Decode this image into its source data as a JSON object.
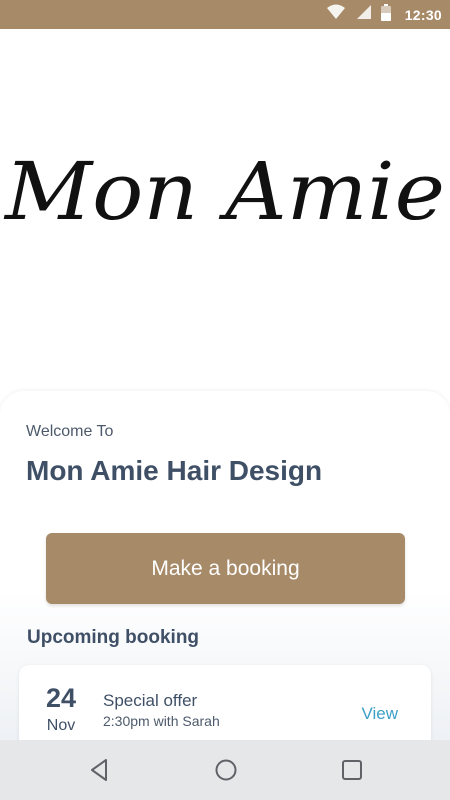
{
  "status_bar": {
    "time": "12:30",
    "icons": [
      "wifi-icon",
      "signal-icon",
      "battery-icon"
    ],
    "color": "#a78b69"
  },
  "logo": {
    "text": "Mon Amie"
  },
  "welcome": {
    "greeting": "Welcome To",
    "salon_name": "Mon Amie Hair Design"
  },
  "booking_button": {
    "label": "Make a booking",
    "color": "#a78b69"
  },
  "upcoming": {
    "title": "Upcoming booking",
    "item": {
      "day": "24",
      "month": "Nov",
      "title": "Special offer",
      "details": "2:30pm with Sarah",
      "action": "View"
    }
  },
  "nav_bar": {
    "buttons": [
      "back-icon",
      "home-icon",
      "recents-icon"
    ]
  },
  "colors": {
    "heading": "#3f5066",
    "link": "#3b9fc6",
    "accent": "#a78b69"
  }
}
